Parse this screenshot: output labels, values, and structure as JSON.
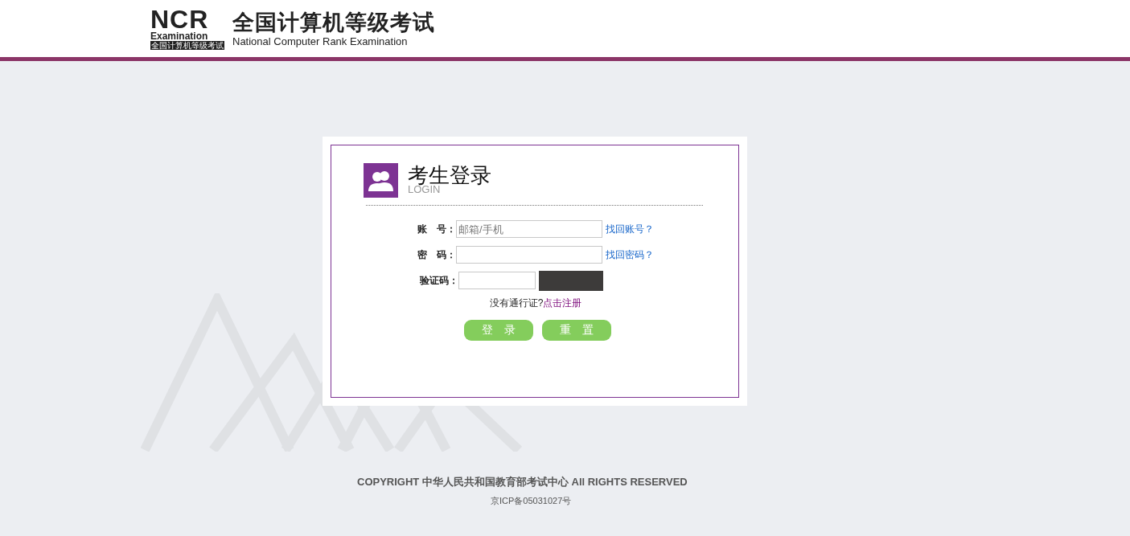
{
  "header": {
    "logo": {
      "mark": "NCR",
      "word": "Examination",
      "caption": "全国计算机等级考试"
    },
    "title": "全国计算机等级考试",
    "subtitle": "National Computer Rank Examination"
  },
  "login": {
    "title": "考生登录",
    "subtitle": "LOGIN",
    "fields": [
      {
        "kind": "text",
        "label": "账　号：",
        "placeholder": "邮箱/手机",
        "link": "找回账号？"
      },
      {
        "kind": "password",
        "label": "密　码：",
        "link": "找回密码？"
      },
      {
        "kind": "captcha",
        "label": "验证码："
      }
    ],
    "register": {
      "prompt": "没有通行证?",
      "link": "点击注册"
    },
    "buttons": [
      "登　录",
      "重　置"
    ]
  },
  "footer": {
    "copyright": "COPYRIGHT 中华人民共和国教育部考试中心 All RIGHTS RESERVED",
    "icp": "京ICP备05031027号"
  }
}
